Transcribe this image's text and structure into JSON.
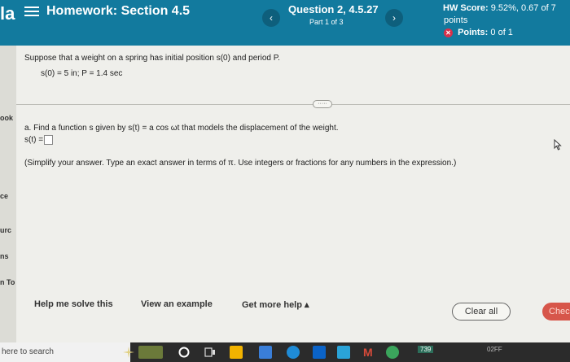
{
  "header": {
    "brand": "la",
    "title": "Homework: Section 4.5",
    "nav_prev": "‹",
    "nav_next": "›",
    "question": "Question 2, 4.5.27",
    "part": "Part 1 of 3",
    "score_label": "HW Score:",
    "score_value": "9.52%, 0.67 of 7",
    "score_unit": "points",
    "points_label": "Points:",
    "points_value": "0 of 1",
    "x_glyph": "✕"
  },
  "sidebar": {
    "items": [
      "ook",
      "ce",
      "urc",
      "ns",
      "n To"
    ]
  },
  "question_body": {
    "prompt": "Suppose that a weight on a spring has initial position s(0) and period P.",
    "given": "s(0) = 5 in; P = 1.4 sec",
    "more_indicator": "·····",
    "part_a_text": "a. Find a function s given by s(t) = a cos ωt that models the displacement of the weight.",
    "answer_prefix": "s(t) =",
    "instructions": "(Simplify your answer. Type an exact answer in terms of π. Use integers or fractions for any numbers in the expression.)"
  },
  "footer": {
    "help_solve": "Help me solve this",
    "view_example": "View an example",
    "more_help": "Get more help ▴",
    "clear_all": "Clear all",
    "check": "Chec"
  },
  "taskbar": {
    "search_placeholder": "here to search",
    "badge": "739",
    "clock_fragment": "02FF"
  },
  "colors": {
    "header_bg": "#127a9e",
    "check_bg": "#d7564a",
    "error_red": "#d9304a"
  },
  "icons": [
    "menu-icon",
    "chevron-left-icon",
    "chevron-right-icon",
    "x-circle-icon",
    "mouse-cursor-icon",
    "taskbar-app-icons"
  ]
}
